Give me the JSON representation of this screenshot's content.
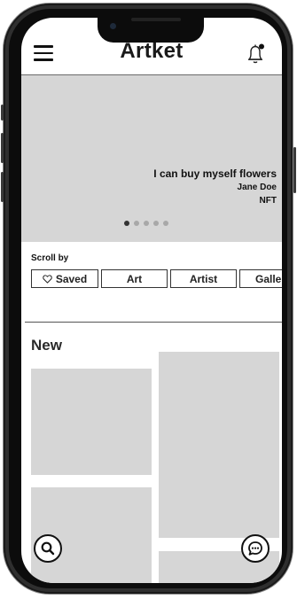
{
  "app": {
    "title": "Artket"
  },
  "hero": {
    "title": "I can buy myself flowers",
    "author": "Jane Doe",
    "type": "NFT",
    "slides": 5,
    "active_slide": 1
  },
  "scroll_by": {
    "label": "Scroll by",
    "chips": [
      {
        "label": "Saved",
        "icon": "heart-outline-icon"
      },
      {
        "label": "Art"
      },
      {
        "label": "Artist"
      },
      {
        "label": "Galle"
      }
    ]
  },
  "new_section": {
    "title": "New"
  },
  "icons": {
    "menu": "hamburger-menu-icon",
    "notifications": "bell-notification-icon",
    "search": "search-icon",
    "chat": "chat-bubble-icon"
  },
  "colors": {
    "placeholder": "#d6d6d6",
    "text": "#111111",
    "frame": "#2f2f2f"
  }
}
